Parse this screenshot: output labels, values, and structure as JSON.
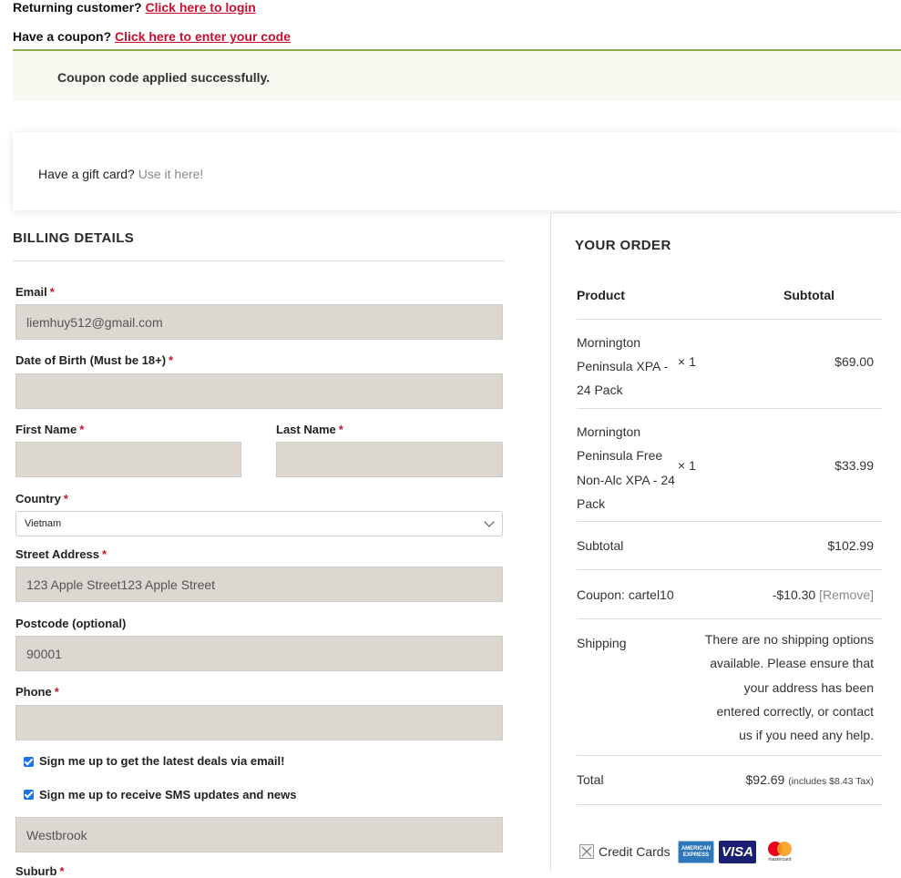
{
  "notices": {
    "returning_prompt": "Returning customer?",
    "returning_link": "Click here to login",
    "coupon_prompt": "Have a coupon?",
    "coupon_link": "Click here to enter your code",
    "coupon_success": "Coupon code applied successfully.",
    "gift_prompt": "Have a gift card?",
    "gift_link": "Use it here!"
  },
  "billing": {
    "title": "BILLING DETAILS",
    "email_label": "Email",
    "email_value": "liemhuy512@gmail.com",
    "dob_label": "Date of Birth (Must be 18+)",
    "dob_value": "",
    "first_name_label": "First Name",
    "first_name_value": "",
    "last_name_label": "Last Name",
    "last_name_value": "",
    "country_label": "Country",
    "country_value": "Vietnam",
    "street_label": "Street Address",
    "street_value": "123 Apple Street123 Apple Street",
    "postcode_label": "Postcode (optional)",
    "postcode_value": "90001",
    "phone_label": "Phone",
    "phone_value": "",
    "newsletter_label": "Sign me up to get the latest deals via email!",
    "sms_label": "Sign me up to receive SMS updates and news",
    "city_value": "Westbrook",
    "suburb_label": "Suburb",
    "required_mark": "*"
  },
  "order": {
    "title": "YOUR ORDER",
    "col_product": "Product",
    "col_subtotal": "Subtotal",
    "items": [
      {
        "name_lines": [
          "Mornington",
          "Peninsula XPA -",
          "24 Pack"
        ],
        "qty": "× 1",
        "price": "$69.00"
      },
      {
        "name_lines": [
          "Mornington",
          "Peninsula Free",
          "Non-Alc XPA - 24",
          "Pack"
        ],
        "qty": "× 1",
        "price": "$33.99"
      }
    ],
    "subtotal_label": "Subtotal",
    "subtotal_value": "$102.99",
    "coupon_label": "Coupon: cartel10",
    "coupon_value": "-$10.30",
    "coupon_remove": "[Remove]",
    "shipping_label": "Shipping",
    "shipping_lines": [
      "There are no shipping options",
      "available. Please ensure that",
      "your address has been",
      "entered correctly, or contact",
      "us if you need any help."
    ],
    "total_label": "Total",
    "total_value": "$92.69",
    "total_tax": "(includes $8.43 Tax)"
  },
  "payment": {
    "method_label": "Credit Cards",
    "amex_text": "AMERICAN EXPRESS",
    "visa_text": "VISA",
    "mastercard_text": "mastercard",
    "colors": {
      "amex": "#2e77bb",
      "visa": "#1a1f71",
      "mc_red": "#eb001b",
      "mc_orange": "#f79e1b"
    }
  }
}
